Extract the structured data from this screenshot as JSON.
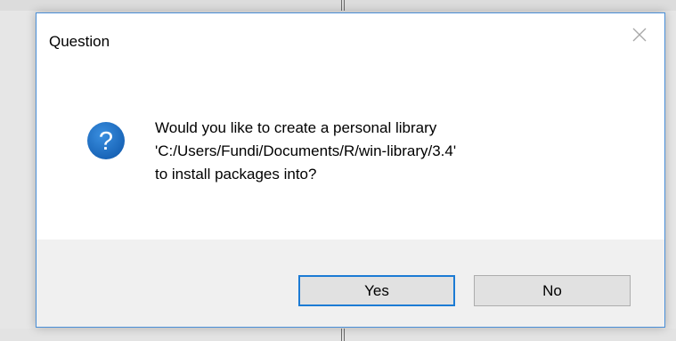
{
  "dialog": {
    "title": "Question",
    "message_lines": [
      "Would you like to create a personal library",
      "'C:/Users/Fundi/Documents/R/win-library/3.4'",
      "to install packages into?"
    ],
    "buttons": {
      "yes_label": "Yes",
      "no_label": "No"
    },
    "icon": "question-icon"
  },
  "colors": {
    "accent": "#1c7bd4",
    "icon_blue": "#1f6fbf",
    "button_area": "#f0f0f0"
  }
}
